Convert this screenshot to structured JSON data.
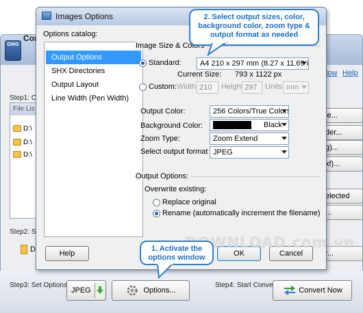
{
  "main": {
    "logo": "DWG",
    "title": "Con",
    "menu_now": "low",
    "menu_help": "Help",
    "step1": "Step1: Ch",
    "step2": "Step2: Se",
    "step3": "Step3: Set Options:",
    "step4": "Step4: Start Convert",
    "file_list_header": "File Lis",
    "files": [
      "D:\\",
      "D:\\",
      "D:\\"
    ],
    "side_buttons": [
      "le...",
      "der...",
      "g)...",
      "xf)...",
      "elected",
      "...",
      "r..."
    ],
    "folder_row": "D",
    "format_value": "JPEG",
    "options_button": "Options...",
    "convert_button": "Convert Now"
  },
  "dialog": {
    "title": "Images Options",
    "catalog_label": "Options catalog:",
    "catalog": [
      "Output Options",
      "SHX Directories",
      "Output Layout",
      "Line Width (Pen Width)"
    ],
    "size_group": "Image Size & Colors",
    "standard_label": "Standard:",
    "standard_value": "A4 210 x 297 mm (8.27 x 11.69 in.)",
    "current_size_label": "Current Size:",
    "current_size_value": "793 x 1122 px",
    "custom_label": "Custom:",
    "width_label": "Width:",
    "width_value": "210",
    "height_label": "Height:",
    "height_value": "297",
    "units_label": "Units:",
    "units_value": "mm",
    "output_color_label": "Output Color:",
    "output_color_value": "256 Colors/True Colors",
    "bg_color_label": "Background Color:",
    "bg_color_value": "Black",
    "zoom_label": "Zoom Type:",
    "zoom_value": "Zoom Extend",
    "format_label": "Select output format",
    "format_value": "JPEG",
    "output_group": "Output Options:",
    "overwrite_label": "Overwrite existing:",
    "replace_label": "Replace original",
    "rename_label": "Rename (automatically increment the filename)",
    "help_button": "Help",
    "ok_button": "OK",
    "cancel_button": "Cancel"
  },
  "callouts": {
    "top": "2. Select output sizes, color, background color, zoom type & output format as needed",
    "bottom": "1. Activate the options window"
  },
  "watermark": "DOWNLOAD.com.vn",
  "colors": {
    "selection": "#3399ff",
    "callout": "#2b7fd2",
    "swatch": "#000000"
  }
}
